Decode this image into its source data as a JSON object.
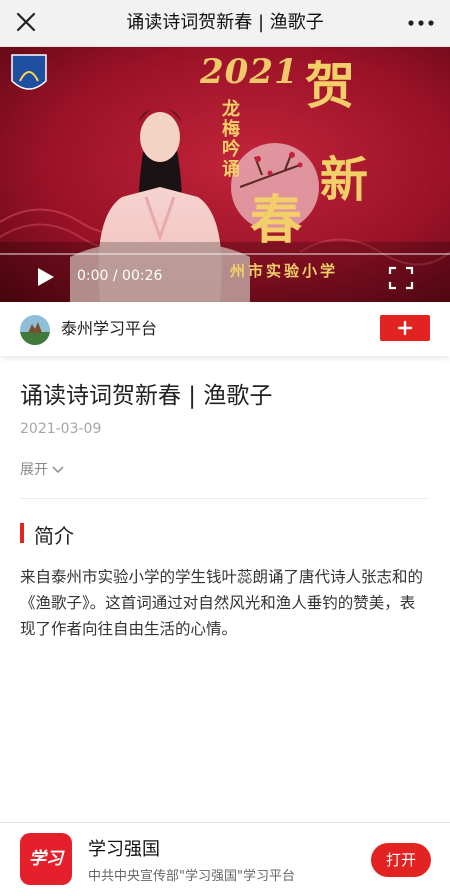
{
  "header": {
    "title": "诵读诗词贺新春 | 渔歌子",
    "close_icon": "close-icon",
    "more_icon": "more-dots-icon"
  },
  "video": {
    "overlay_year": "2021",
    "overlay_he": "贺",
    "overlay_xin": "新",
    "overlay_chun": "春",
    "overlay_subtitle": "龙梅吟诵",
    "overlay_school": "州市实验小学",
    "time": "0:00 / 00:26",
    "progress": 0,
    "play_icon": "play-icon",
    "fullscreen_icon": "fullscreen-icon"
  },
  "author": {
    "name": "泰州学习平台",
    "follow_icon": "plus-icon"
  },
  "article": {
    "title": "诵读诗词贺新春 | 渔歌子",
    "date": "2021-03-09",
    "expand_label": "展开"
  },
  "intro": {
    "heading": "简介",
    "text": "来自泰州市实验小学的学生钱叶蕊朗诵了唐代诗人张志和的《渔歌子》。这首词通过对自然风光和渔人垂钓的赞美，表现了作者向往自由生活的心情。"
  },
  "banner": {
    "logo_text": "学习",
    "app_name": "学习强国",
    "app_desc": "中共中央宣传部\"学习强国\"学习平台",
    "open_label": "打开"
  },
  "colors": {
    "accent": "#e32321",
    "video_bg": "#8e0f22",
    "gold": "#f3cf6a"
  }
}
